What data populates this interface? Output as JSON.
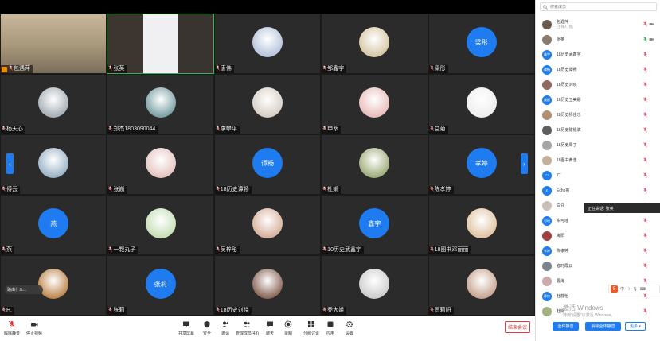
{
  "grid": {
    "tiles": [
      {
        "name": "包遇萍",
        "type": "video",
        "host": true
      },
      {
        "name": "张英",
        "type": "video2",
        "active": true
      },
      {
        "name": "唐伟",
        "type": "photo",
        "color": "#b9c6dd"
      },
      {
        "name": "邹鑫宇",
        "type": "photo",
        "color": "#d8c9a8"
      },
      {
        "name": "梁彤",
        "type": "text",
        "avatar_text": "梁彤"
      },
      {
        "name": "杨天心",
        "type": "photo",
        "color": "#a8b2b8"
      },
      {
        "name": "郑杰1803090044",
        "type": "photo",
        "color": "#7fa3a8"
      },
      {
        "name": "李攀平",
        "type": "photo",
        "color": "#d9d0c8"
      },
      {
        "name": "申萃",
        "type": "photo",
        "color": "#e9c0bd"
      },
      {
        "name": "益菊",
        "type": "photo",
        "color": "#efefef"
      },
      {
        "name": "傅云",
        "type": "photo",
        "color": "#9fb6c9"
      },
      {
        "name": "张巍",
        "type": "photo",
        "color": "#e6c7c4"
      },
      {
        "name": "18历史谭畅",
        "type": "text",
        "avatar_text": "谭畅"
      },
      {
        "name": "杜娟",
        "type": "photo",
        "color": "#a2b07f"
      },
      {
        "name": "陈孝婷",
        "type": "text",
        "avatar_text": "孝婷"
      },
      {
        "name": "燕",
        "type": "text",
        "avatar_text": "燕"
      },
      {
        "name": "一颗丸子",
        "type": "photo",
        "color": "#c7e0b7"
      },
      {
        "name": "吴梓彤",
        "type": "photo",
        "color": "#d8b39e"
      },
      {
        "name": "10历史武鑫宇",
        "type": "text",
        "avatar_text": "鑫宇"
      },
      {
        "name": "18图书邓丽丽",
        "type": "photo",
        "color": "#e2c6a6"
      },
      {
        "name": "H.",
        "type": "photo",
        "color": "#c08a52"
      },
      {
        "name": "张莉",
        "type": "text",
        "avatar_text": "张莉"
      },
      {
        "name": "18历史刘晓",
        "type": "photo",
        "color": "#8d6a5c"
      },
      {
        "name": "乔大姐",
        "type": "photo",
        "color": "#cfcfcf"
      },
      {
        "name": "贾莉阳",
        "type": "photo",
        "color": "#c9a896"
      }
    ],
    "speaking_chip": "路由什么..."
  },
  "toolbar": {
    "mute": "解除静音",
    "stop_video": "停止视频",
    "share": "共享屏幕",
    "security": "安全",
    "invite": "邀请",
    "manage": "管理成员(43)",
    "chat": "聊天",
    "record": "录制",
    "breakout": "分组讨论",
    "apps": "应用",
    "settings": "设置",
    "end": "结束会议"
  },
  "panel": {
    "search_placeholder": "搜索成员",
    "members": [
      {
        "name": "包遇萍",
        "sub": "(主持人, 我)",
        "type": "photo",
        "color": "#6b5a4e"
      },
      {
        "name": "张英",
        "type": "photo",
        "color": "#8a7b70"
      },
      {
        "name": "18历史武鑫宇",
        "type": "text",
        "avatar": "鑫宇"
      },
      {
        "name": "18历史谭畅",
        "type": "text",
        "avatar": "谭畅"
      },
      {
        "name": "18历史刘晓",
        "type": "photo",
        "color": "#8d6a5c"
      },
      {
        "name": "18历史王美娜",
        "type": "text",
        "avatar": "美娜"
      },
      {
        "name": "18历史杨佳乐",
        "type": "photo",
        "color": "#b09070"
      },
      {
        "name": "18历史陈银滨",
        "type": "photo",
        "color": "#5e5e5e"
      },
      {
        "name": "18历史周丁",
        "type": "photo",
        "color": "#a6a6a6"
      },
      {
        "name": "18图书黄浩",
        "type": "photo",
        "color": "#c4b09a"
      },
      {
        "name": "77",
        "type": "text",
        "avatar": "77"
      },
      {
        "name": "Echo苗",
        "type": "text",
        "avatar": "E"
      },
      {
        "name": "白豆",
        "type": "photo",
        "color": "#c9c0bb"
      },
      {
        "name": "东可瑶",
        "type": "text",
        "avatar": "可瑶"
      },
      {
        "name": "海阳",
        "type": "photo",
        "color": "#a04040"
      },
      {
        "name": "陈孝婷",
        "type": "text",
        "avatar": "孝婷"
      },
      {
        "name": "者时霞云",
        "type": "photo",
        "color": "#7b8590"
      },
      {
        "name": "曹海",
        "type": "photo",
        "color": "#caa"
      },
      {
        "name": "杜静怡",
        "type": "text",
        "avatar": "静怡"
      },
      {
        "name": "杜娟",
        "type": "photo",
        "color": "#a2b07f"
      }
    ],
    "tooltip": "正在讲话: 张英",
    "ime_label": "中",
    "mute_all": "全体静音",
    "unmute_all": "解除全体静音",
    "more": "更多 ▾"
  },
  "watermark": {
    "title": "激活 Windows",
    "sub": "转到\"设置\"以激活 Windows。"
  },
  "colors": {
    "accent": "#1f7cf0",
    "active_border": "#39b54a",
    "danger": "#e0393e"
  }
}
